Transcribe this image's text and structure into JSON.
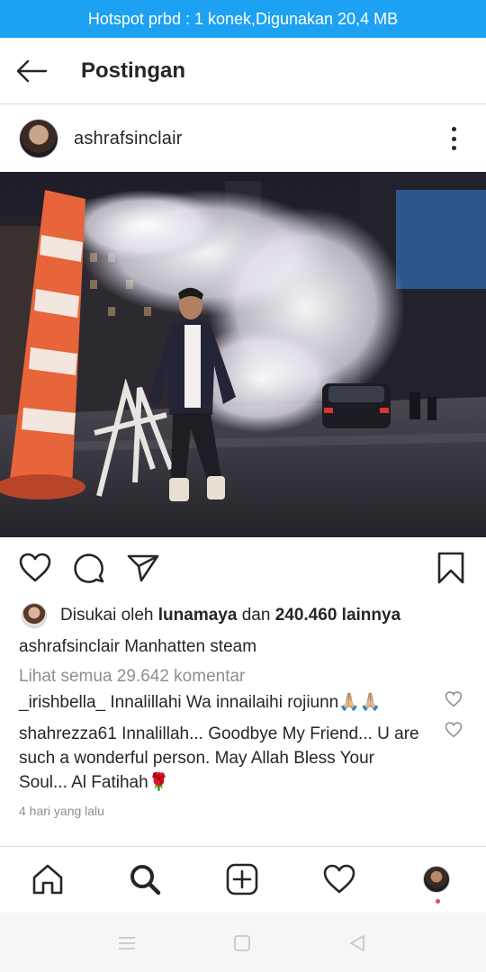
{
  "status": {
    "hotspot_text": "Hotspot prbd : 1 konek,Digunakan 20,4 MB",
    "color": "#1da1f2"
  },
  "header": {
    "title": "Postingan"
  },
  "post": {
    "username": "ashrafsinclair",
    "likes_prefix": "Disukai oleh",
    "liker": "lunamaya",
    "likes_connector": "dan",
    "likes_count": "240.460 lainnya",
    "caption_user": "ashrafsinclair",
    "caption_text": "Manhatten steam",
    "view_comments": "Lihat semua 29.642 komentar",
    "comments": [
      {
        "user": "_irishbella_",
        "text": "Innalillahi Wa innailaihi rojiunn🙏🏼🙏🏼"
      },
      {
        "user": "shahrezza61",
        "text": "Innalillah... Goodbye My Friend... U are such a wonderful person. May Allah Bless Your Soul... Al Fatihah🌹"
      }
    ],
    "timestamp": "4 hari yang lalu"
  },
  "icons": {
    "back": "arrow-left-icon",
    "more": "more-vertical-icon",
    "like": "heart-icon",
    "comment": "comment-bubble-icon",
    "share": "paper-plane-icon",
    "save": "bookmark-icon",
    "nav": [
      "home-icon",
      "search-icon",
      "add-post-icon",
      "activity-heart-icon",
      "profile-avatar"
    ],
    "system": [
      "menu-icon",
      "square-icon",
      "back-triangle-icon"
    ]
  },
  "colors": {
    "notification_dot": "#ed4956",
    "secondary_text": "#8e8e8e"
  }
}
